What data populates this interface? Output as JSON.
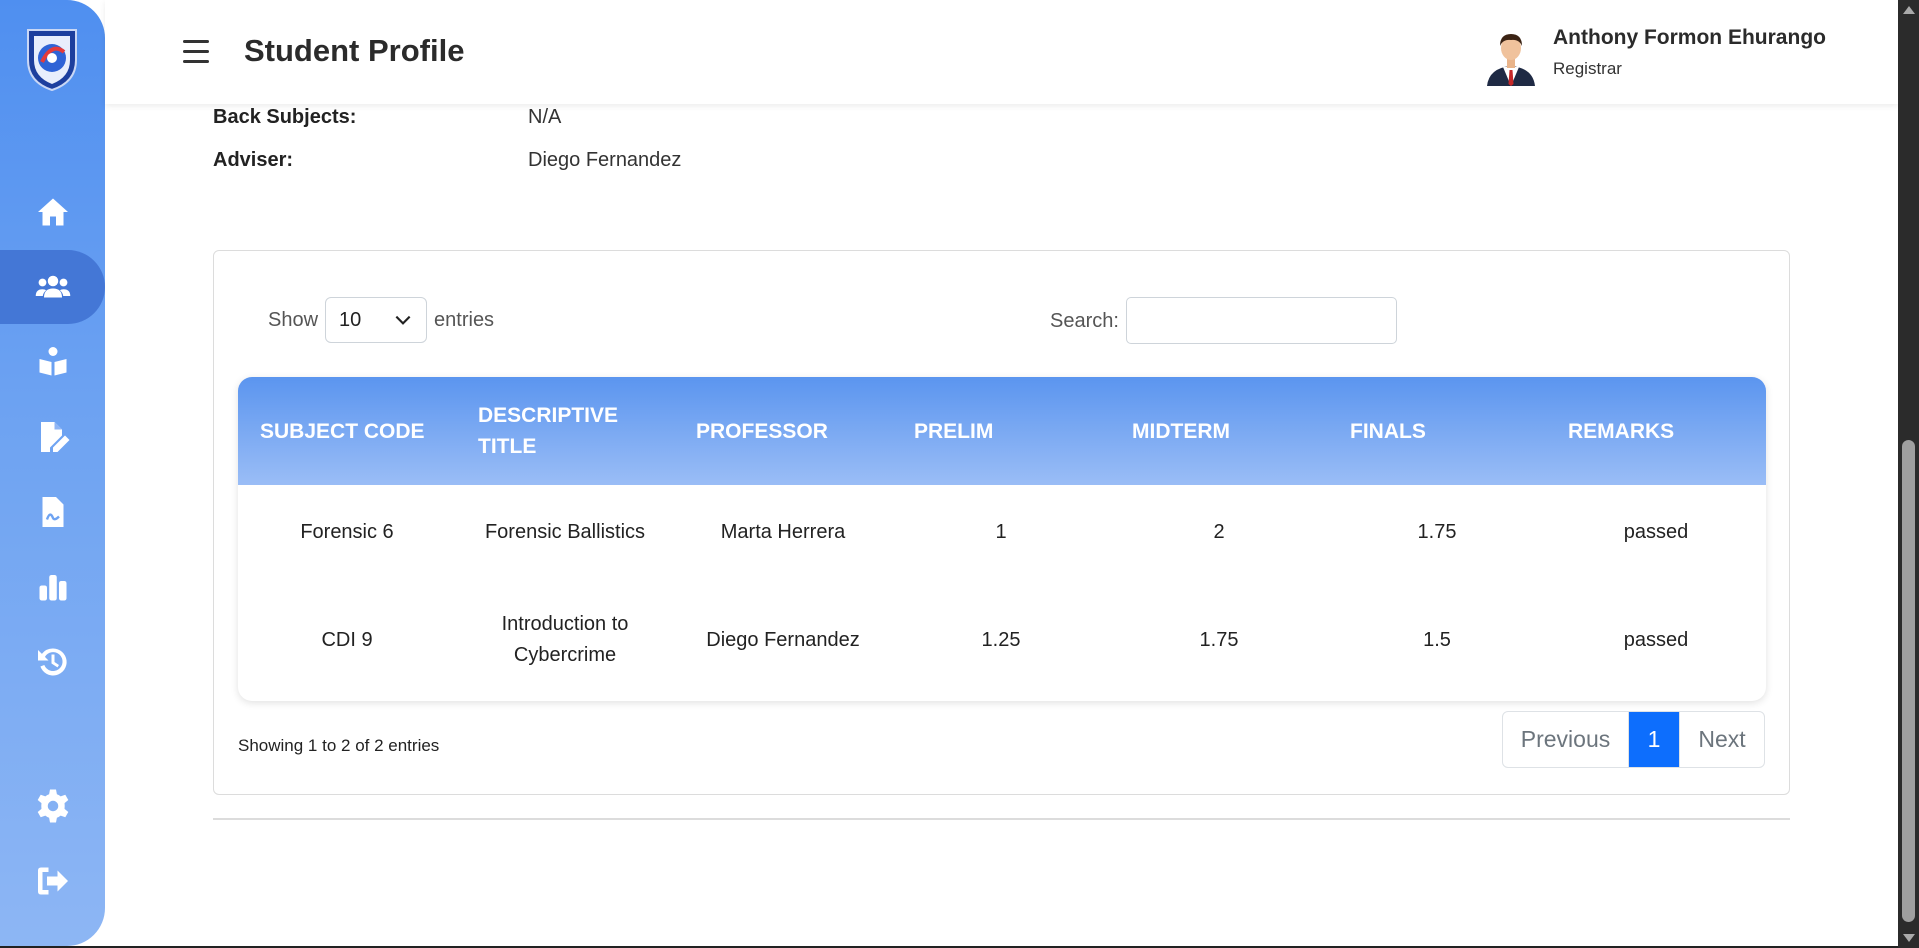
{
  "header": {
    "title": "Student Profile",
    "user_name": "Anthony Formon Ehurango",
    "user_role": "Registrar"
  },
  "sidebar": {
    "items": [
      {
        "icon": "home-icon"
      },
      {
        "icon": "users-icon",
        "active": true
      },
      {
        "icon": "book-reader-icon"
      },
      {
        "icon": "file-edit-icon"
      },
      {
        "icon": "file-signature-icon"
      },
      {
        "icon": "bar-chart-icon"
      },
      {
        "icon": "history-icon"
      },
      {
        "icon": "gear-icon"
      },
      {
        "icon": "logout-icon"
      }
    ]
  },
  "info": [
    {
      "label": "Back Subjects:",
      "value": "N/A"
    },
    {
      "label": "Adviser:",
      "value": "Diego Fernandez"
    }
  ],
  "table_controls": {
    "show_label": "Show",
    "entries_value": "10",
    "entries_label": "entries",
    "search_label": "Search:",
    "search_value": ""
  },
  "table": {
    "columns": [
      "SUBJECT CODE",
      "DESCRIPTIVE TITLE",
      "PROFESSOR",
      "PRELIM",
      "MIDTERM",
      "FINALS",
      "REMARKS"
    ],
    "rows": [
      [
        "Forensic 6",
        "Forensic Ballistics",
        "Marta Herrera",
        "1",
        "2",
        "1.75",
        "passed"
      ],
      [
        "CDI 9",
        "Introduction to Cybercrime",
        "Diego Fernandez",
        "1.25",
        "1.75",
        "1.5",
        "passed"
      ]
    ]
  },
  "footer": {
    "showing": "Showing 1 to 2 of 2 entries",
    "prev": "Previous",
    "page": "1",
    "next": "Next"
  },
  "colors": {
    "sidebar": "#4f8ff0",
    "active_nav": "#4477d6",
    "pagination_active": "#0d6efd"
  }
}
